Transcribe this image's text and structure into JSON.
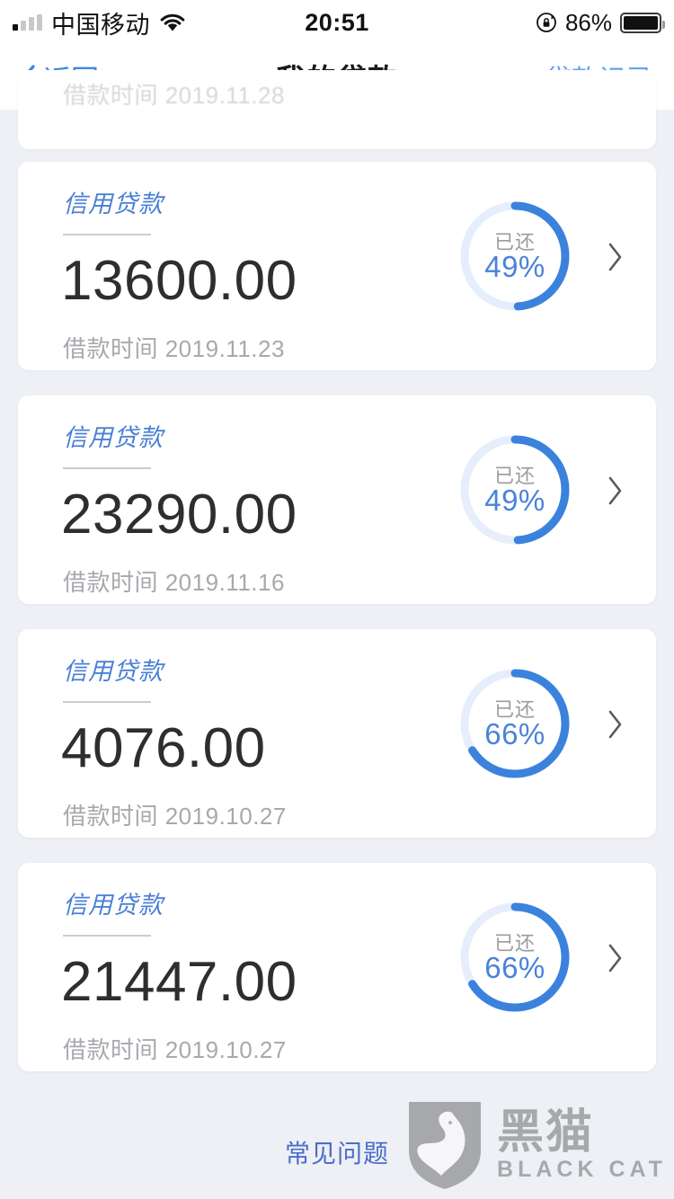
{
  "status_bar": {
    "carrier": "中国移动",
    "wifi_icon": "wifi-icon",
    "signal_icon": "signal-bars-icon",
    "time": "20:51",
    "rotation_lock_icon": "rotation-lock-icon",
    "battery_percent": "86%",
    "battery_icon": "battery-full-icon"
  },
  "nav": {
    "back_label": "返回",
    "back_icon": "chevron-left-icon",
    "title": "我的贷款",
    "action_label": "贷款记录"
  },
  "colors": {
    "accent_blue": "#3f87e5",
    "ring_blue": "#3b82dd",
    "ring_track": "#e6eefb",
    "label_blue": "#4a7fd4",
    "page_bg": "#eef0f6",
    "card_bg": "#ffffff",
    "muted_text": "#a8a8ae",
    "watermark_gray": "#7d7d7d"
  },
  "partial_card": {
    "ghost_date": "借款时间 2019.11.28"
  },
  "loans": [
    {
      "type": "信用贷款",
      "amount": "13600.00",
      "date": "借款时间 2019.11.23",
      "repaid_label": "已还",
      "repaid_percent": "49%",
      "percent_value": 49,
      "arrow_icon": "chevron-right-icon"
    },
    {
      "type": "信用贷款",
      "amount": "23290.00",
      "date": "借款时间 2019.11.16",
      "repaid_label": "已还",
      "repaid_percent": "49%",
      "percent_value": 49,
      "arrow_icon": "chevron-right-icon"
    },
    {
      "type": "信用贷款",
      "amount": "4076.00",
      "date": "借款时间 2019.10.27",
      "repaid_label": "已还",
      "repaid_percent": "66%",
      "percent_value": 66,
      "arrow_icon": "chevron-right-icon"
    },
    {
      "type": "信用贷款",
      "amount": "21447.00",
      "date": "借款时间 2019.10.27",
      "repaid_label": "已还",
      "repaid_percent": "66%",
      "percent_value": 66,
      "arrow_icon": "chevron-right-icon"
    }
  ],
  "footer": {
    "faq_label": "常见问题",
    "watermark_cn": "黑猫",
    "watermark_en": "BLACK CAT",
    "watermark_icon": "black-cat-shield-logo"
  }
}
